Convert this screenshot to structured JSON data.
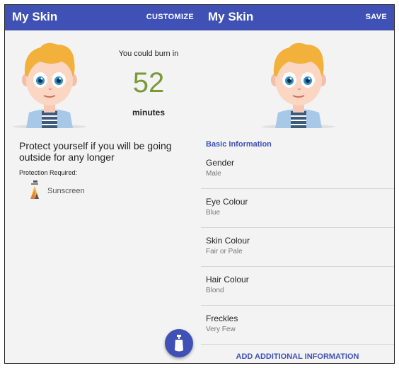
{
  "left": {
    "appbar": {
      "title": "My Skin",
      "action_label": "CUSTOMIZE"
    },
    "burn": {
      "caption": "You could burn in",
      "minutes": "52",
      "unit": "minutes"
    },
    "protection_message": "Protect yourself if you will be going outside for any longer",
    "protection_label": "Protection Required:",
    "protection_items": [
      {
        "label": "Sunscreen",
        "icon": "sunscreen-icon"
      }
    ],
    "fab": {
      "icon": "sunscreen-bottle-icon"
    }
  },
  "right": {
    "appbar": {
      "title": "My Skin",
      "action_label": "SAVE"
    },
    "section_title": "Basic Information",
    "info": [
      {
        "key": "Gender",
        "value": "Male"
      },
      {
        "key": "Eye Colour",
        "value": "Blue"
      },
      {
        "key": "Skin Colour",
        "value": "Fair or Pale"
      },
      {
        "key": "Hair Colour",
        "value": "Blond"
      },
      {
        "key": "Freckles",
        "value": "Very Few"
      }
    ],
    "add_info_label": "ADD ADDITIONAL INFORMATION"
  },
  "colors": {
    "appbar": "#3f51b5",
    "accent": "#3f51b5",
    "burn_number": "#7a9a3a",
    "hair": "#f2b13b",
    "shirt_stripe": "#3d5a7a"
  }
}
